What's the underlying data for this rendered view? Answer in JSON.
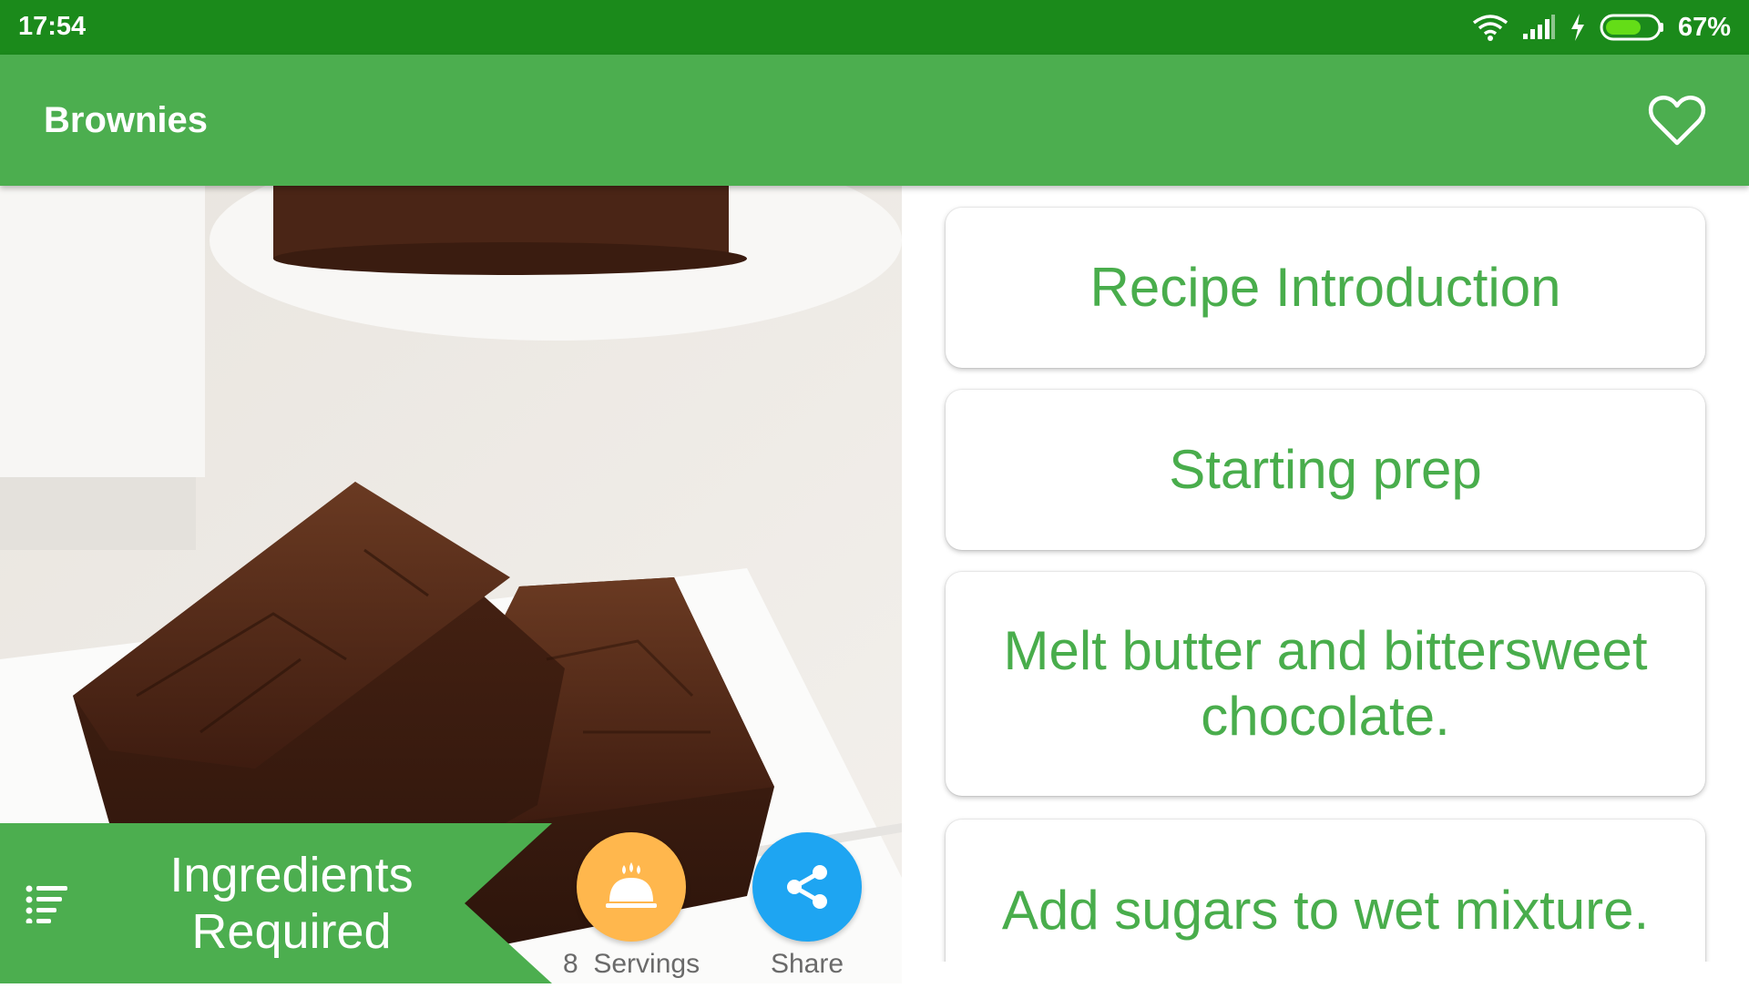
{
  "status_bar": {
    "time": "17:54",
    "battery": "67%",
    "icons": [
      "wifi-icon",
      "signal-icon",
      "charging-icon",
      "battery-icon"
    ]
  },
  "app_bar": {
    "title": "Brownies",
    "favorite_icon": "heart-outline-icon"
  },
  "hero": {
    "image": "brownies-photo"
  },
  "ingredients": {
    "label": "Ingredients Required",
    "icon": "list-icon"
  },
  "servings": {
    "count": "8",
    "label": "Servings",
    "icon": "cloche-icon",
    "color": "#ffb74d"
  },
  "share": {
    "label": "Share",
    "icon": "share-icon",
    "color": "#1ea5f2"
  },
  "steps": [
    {
      "title": "Recipe Introduction"
    },
    {
      "title": "Starting prep"
    },
    {
      "title": "Melt butter and bittersweet chocolate."
    },
    {
      "title": "Add sugars to wet mixture."
    }
  ],
  "colors": {
    "status_bar": "#1b8a1b",
    "app_bar": "#4cae4f",
    "accent_text": "#49ad4c"
  }
}
